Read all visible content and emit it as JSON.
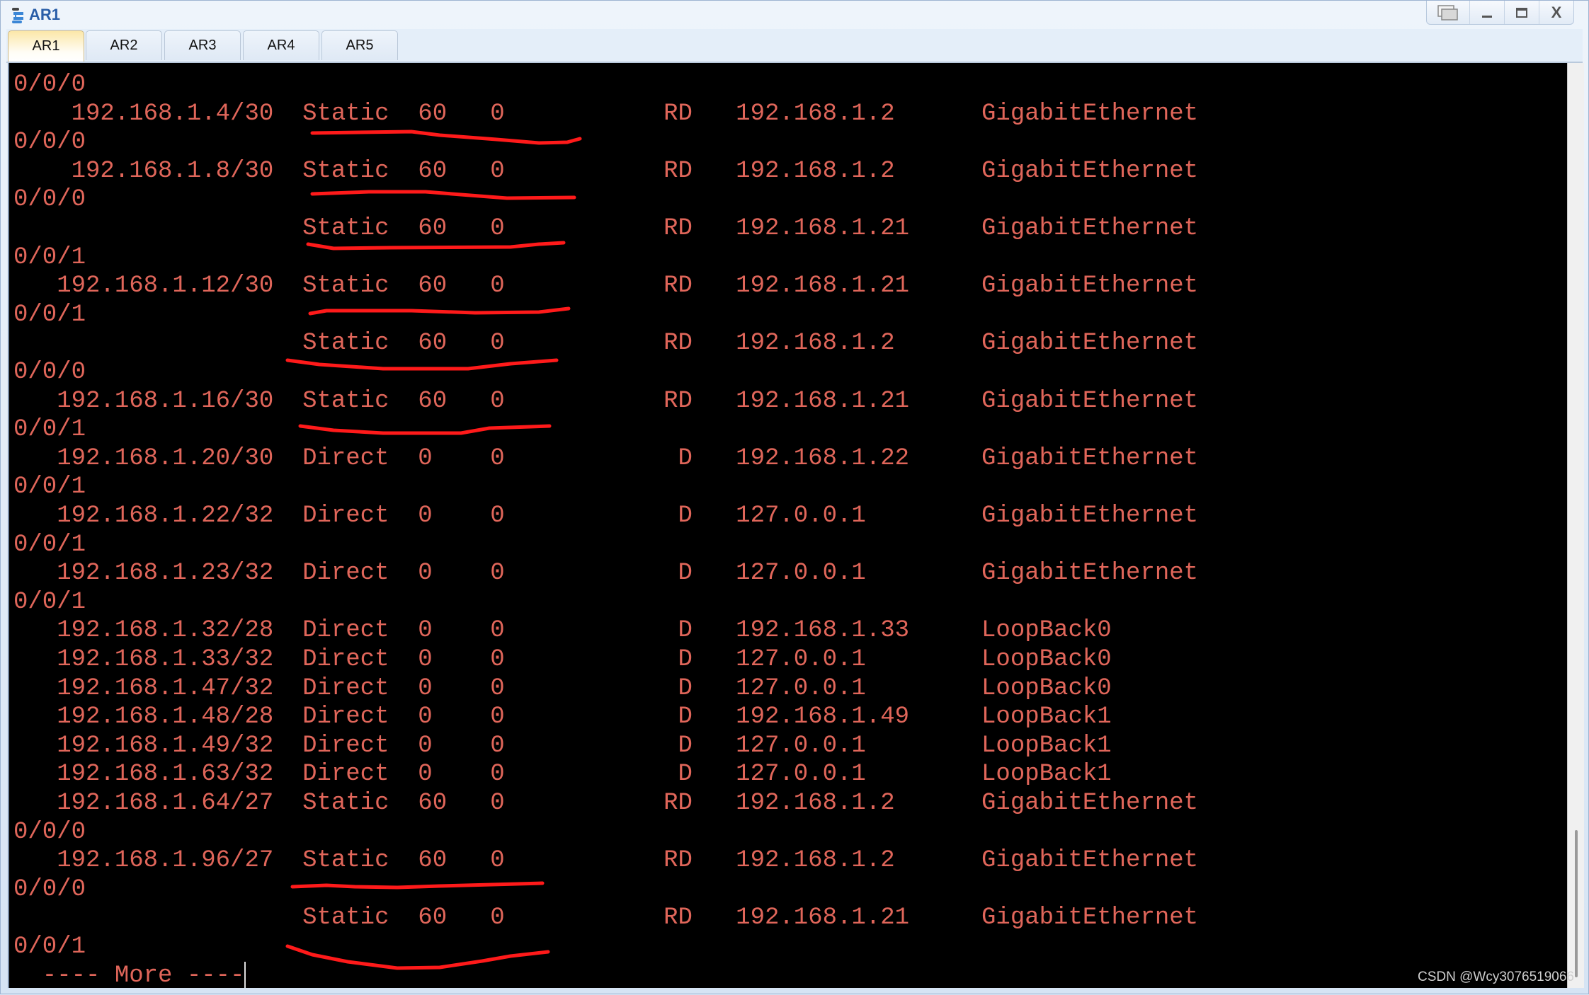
{
  "window": {
    "title": "AR1",
    "controls": {
      "restore_label": "❐",
      "minimize_label": "—",
      "maximize_label": "▭",
      "close_label": "X"
    }
  },
  "tabs": [
    {
      "label": "AR1",
      "active": true
    },
    {
      "label": "AR2",
      "active": false
    },
    {
      "label": "AR3",
      "active": false
    },
    {
      "label": "AR4",
      "active": false
    },
    {
      "label": "AR5",
      "active": false
    }
  ],
  "terminal": {
    "text_color": "#e0665a",
    "lines": [
      "0/0/0",
      "    192.168.1.4/30  Static  60   0           RD   192.168.1.2      GigabitEthernet",
      "0/0/0",
      "    192.168.1.8/30  Static  60   0           RD   192.168.1.2      GigabitEthernet",
      "0/0/0",
      "                    Static  60   0           RD   192.168.1.21     GigabitEthernet",
      "0/0/1",
      "   192.168.1.12/30  Static  60   0           RD   192.168.1.21     GigabitEthernet",
      "0/0/1",
      "                    Static  60   0           RD   192.168.1.2      GigabitEthernet",
      "0/0/0",
      "   192.168.1.16/30  Static  60   0           RD   192.168.1.21     GigabitEthernet",
      "0/0/1",
      "   192.168.1.20/30  Direct  0    0            D   192.168.1.22     GigabitEthernet",
      "0/0/1",
      "   192.168.1.22/32  Direct  0    0            D   127.0.0.1        GigabitEthernet",
      "0/0/1",
      "   192.168.1.23/32  Direct  0    0            D   127.0.0.1        GigabitEthernet",
      "0/0/1",
      "   192.168.1.32/28  Direct  0    0            D   192.168.1.33     LoopBack0",
      "   192.168.1.33/32  Direct  0    0            D   127.0.0.1        LoopBack0",
      "   192.168.1.47/32  Direct  0    0            D   127.0.0.1        LoopBack0",
      "   192.168.1.48/28  Direct  0    0            D   192.168.1.49     LoopBack1",
      "   192.168.1.49/32  Direct  0    0            D   127.0.0.1        LoopBack1",
      "   192.168.1.63/32  Direct  0    0            D   127.0.0.1        LoopBack1",
      "   192.168.1.64/27  Static  60   0           RD   192.168.1.2      GigabitEthernet",
      "0/0/0",
      "   192.168.1.96/27  Static  60   0           RD   192.168.1.2      GigabitEthernet",
      "0/0/0",
      "                    Static  60   0           RD   192.168.1.21     GigabitEthernet",
      "0/0/1"
    ],
    "more_prompt": "  ---- More ----"
  },
  "annotations": {
    "stroke_color": "#ff1a1a",
    "description": "hand-drawn red underlines beneath Static route entries"
  },
  "watermark": "CSDN @Wcy3076519066"
}
